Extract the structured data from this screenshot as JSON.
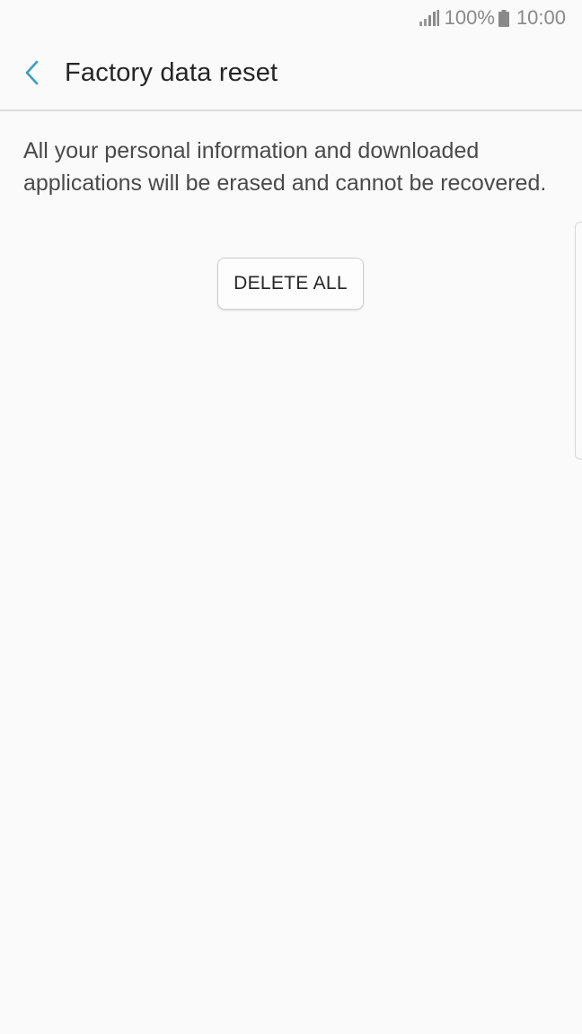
{
  "status_bar": {
    "signal_icon": "signal-icon",
    "battery_percent": "100%",
    "battery_icon": "battery-icon",
    "time": "10:00"
  },
  "header": {
    "back_icon": "chevron-left-icon",
    "title": "Factory data reset"
  },
  "main": {
    "description": "All your personal information and downloaded applications will be erased and cannot be recovered.",
    "delete_all_label": "DELETE ALL"
  },
  "colors": {
    "accent": "#3a9cc4",
    "background": "#fafafa",
    "text_primary": "#252525",
    "text_secondary": "#4a4a4a",
    "status_text": "#8a8a8a"
  }
}
